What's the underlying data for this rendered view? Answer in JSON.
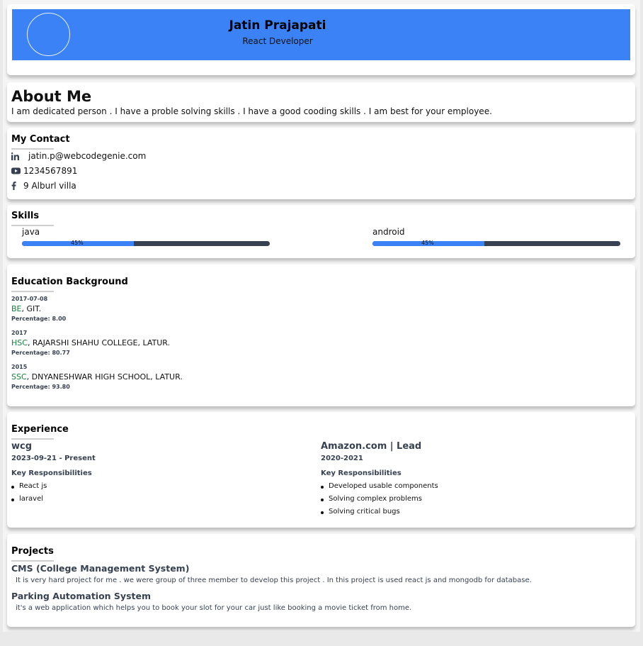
{
  "header": {
    "name": "Jatin Prajapati",
    "role": "React Developer",
    "banner_color": "#3b82f6"
  },
  "about": {
    "title": "About Me",
    "text": "I am dedicated person . I have a proble solving skills . I have a good cooding skills . I am best for your employee."
  },
  "contact": {
    "title": "My Contact",
    "items": [
      {
        "icon": "linkedin-icon",
        "text": "jatin.p@webcodegenie.com"
      },
      {
        "icon": "youtube-icon",
        "text": "1234567891"
      },
      {
        "icon": "facebook-icon",
        "text": "9 Alburl villa"
      }
    ]
  },
  "skills": {
    "title": "Skills",
    "items": [
      {
        "name": "java",
        "percent": 45,
        "label": "45%"
      },
      {
        "name": "android",
        "percent": 45,
        "label": "45%"
      }
    ]
  },
  "education": {
    "title": "Education Background",
    "items": [
      {
        "date": "2017-07-08",
        "degree": "BE",
        "school": ", GIT.",
        "percentage": "Percentage: 8.00"
      },
      {
        "date": "2017",
        "degree": "HSC",
        "school": ", RAJARSHI SHAHU COLLEGE, LATUR.",
        "percentage": "Percentage: 80.77"
      },
      {
        "date": "2015",
        "degree": "SSC",
        "school": ", DNYANESHWAR HIGH SCHOOL, LATUR.",
        "percentage": "Percentage: 93.80"
      }
    ]
  },
  "experience": {
    "title": "Experience",
    "items": [
      {
        "company": "wcg",
        "period": "2023-09-21 - Present",
        "kr_label": "Key Responsibilities",
        "responsibilities": [
          "React js",
          "laravel"
        ]
      },
      {
        "company": "Amazon.com | Lead",
        "period": "2020-2021",
        "kr_label": "Key Responsibilities",
        "responsibilities": [
          "Developed usable components",
          "Solving complex problems",
          "Solving critical bugs"
        ]
      }
    ]
  },
  "projects": {
    "title": "Projects",
    "items": [
      {
        "name": "CMS (College Management System)",
        "description": "It is very hard project for me . we were group of three member to develop this project . In this project is used react js and mongodb for database."
      },
      {
        "name": "Parking Automation System",
        "description": "it's a web application which helps you to book your slot for your car just like booking a movie ticket from home."
      }
    ]
  }
}
